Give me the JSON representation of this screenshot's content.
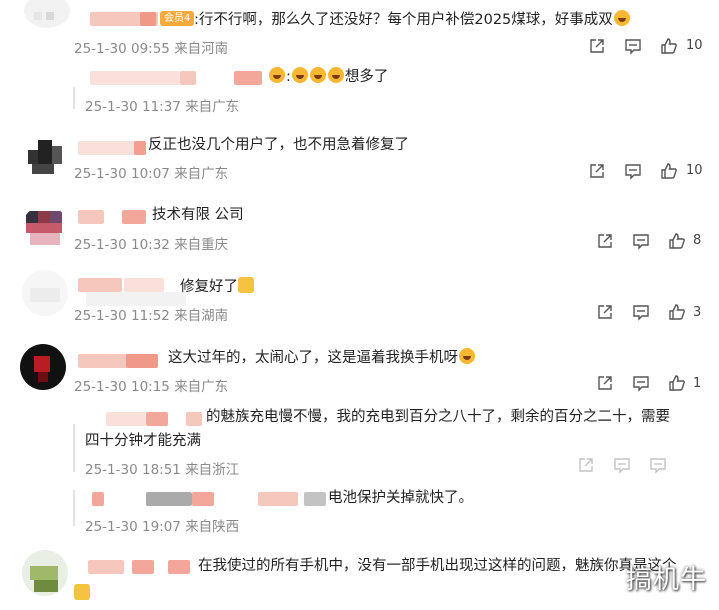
{
  "comments": [
    {
      "text": ":行不行啊，那么久了还没好？每个用户补偿2025煤球，好事成双",
      "badge": "会员4",
      "date": "25-1-30 09:55",
      "loc": "来自河南",
      "likes": "10",
      "reply": {
        "text": "想多了",
        "date": "25-1-30 11:37",
        "loc": "来自广东"
      }
    },
    {
      "text": "反正也没几个用户了，也不用急着修复了",
      "date": "25-1-30 10:07",
      "loc": "来自广东",
      "likes": "10"
    },
    {
      "text": "技术有限  公司",
      "date": "25-1-30 10:32",
      "loc": "来自重庆",
      "likes": "8"
    },
    {
      "text": "修复好了",
      "date": "25-1-30 11:52",
      "loc": "来自湖南",
      "likes": "3"
    },
    {
      "text": "这大过年的，太闹心了，这是逼着我换手机呀",
      "date": "25-1-30 10:15",
      "loc": "来自广东",
      "likes": "1",
      "replies": [
        {
          "text_line1": "的魅族充电慢不慢，我的充电到百分之八十了，剩余的百分之二十，需要",
          "text_line2": "四十分钟才能充满",
          "date": "25-1-30 18:51",
          "loc": "来自浙江"
        },
        {
          "text": "电池保护关掉就快了。",
          "date": "25-1-30 19:07",
          "loc": "来自陕西"
        }
      ]
    },
    {
      "text": "在我使过的所有手机中，没有一部手机出现过这样的问题，魅族你真是这个"
    }
  ],
  "watermark": "搞机牛",
  "icons": {
    "share": "share-icon",
    "comment": "comment-icon",
    "like": "thumbs-up-icon"
  },
  "colors": {
    "meta": "#8a8a8a",
    "icon": "#555555",
    "blur_pink": "#f3b4a6",
    "blur_red": "#ef8a78"
  }
}
